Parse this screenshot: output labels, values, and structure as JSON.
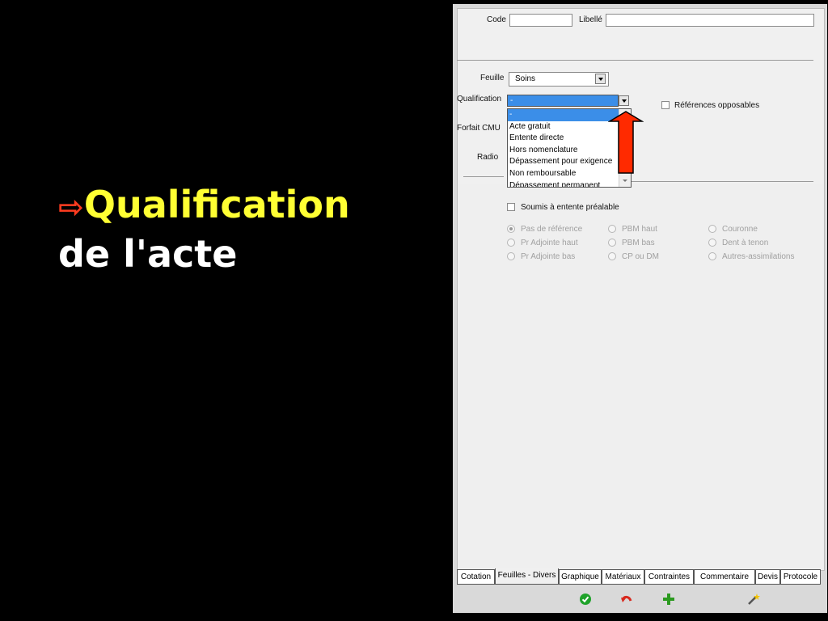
{
  "slide": {
    "arrow": "⇨",
    "title_line1": "Qualification",
    "title_line2": "de l'acte"
  },
  "form": {
    "code_label": "Code",
    "code_value": "",
    "libelle_label": "Libellé",
    "libelle_value": "",
    "feuille_label": "Feuille",
    "feuille_value": "Soins",
    "qualification_label": "Qualification",
    "qualification_value": "-",
    "forfait_label": "Forfait CMU",
    "radio_label": "Radio",
    "refs_opposables": "Références opposables",
    "soumis_entente": "Soumis à entente préalable"
  },
  "qualification_options": [
    "-",
    "Acte gratuit",
    "Entente directe",
    "Hors nomenclature",
    "Dépassement pour exigence",
    "Non remboursable",
    "Dépassement permanent"
  ],
  "radios": {
    "col1": [
      "Pas de référence",
      "Pr Adjointe haut",
      "Pr Adjointe bas"
    ],
    "col2": [
      "PBM haut",
      "PBM bas",
      "CP ou DM"
    ],
    "col3": [
      "Couronne",
      "Dent à tenon",
      "Autres-assimilations"
    ]
  },
  "tabs": [
    "Cotation",
    "Feuilles - Divers",
    "Graphique",
    "Matériaux",
    "Contraintes",
    "Commentaire",
    "Devis",
    "Protocole"
  ],
  "active_tab": "Feuilles - Divers",
  "toolbar": [
    "validate-icon",
    "undo-icon",
    "add-icon",
    "magic-wand-icon"
  ],
  "colors": {
    "title_yellow": "#ffff33",
    "arrow_red": "#ff3b1f",
    "selection_blue": "#3b8ee8",
    "callout_red": "#ff2a00"
  }
}
